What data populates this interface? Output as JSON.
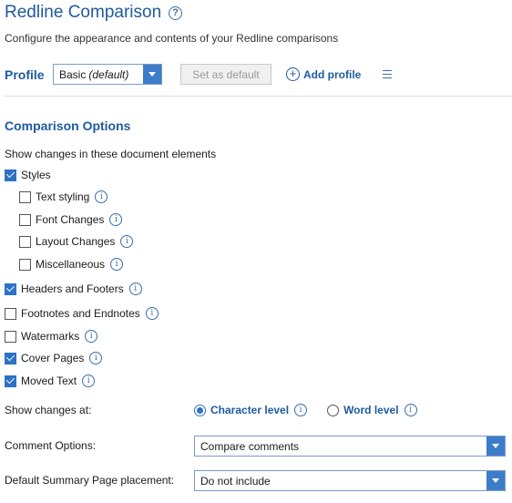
{
  "header": {
    "title": "Redline Comparison",
    "help_icon": "question-circle-icon",
    "subtitle": "Configure the appearance and contents of your Redline comparisons"
  },
  "profile": {
    "label": "Profile",
    "selected_name": "Basic",
    "selected_suffix": "(default)",
    "set_default_label": "Set as default",
    "set_default_enabled": false,
    "add_profile_label": "Add profile",
    "add_icon": "plus-circle-icon",
    "menu_icon": "hamburger-menu-icon"
  },
  "comparison": {
    "section_title": "Comparison Options",
    "elements_label": "Show changes in these document elements",
    "elements": [
      {
        "label": "Styles",
        "checked": true,
        "info": false
      },
      {
        "label": "Text styling",
        "checked": false,
        "info": true
      },
      {
        "label": "Font Changes",
        "checked": false,
        "info": true
      },
      {
        "label": "Layout Changes",
        "checked": false,
        "info": true
      },
      {
        "label": "Miscellaneous",
        "checked": false,
        "info": true
      },
      {
        "label": "Headers and Footers",
        "checked": true,
        "info": true
      },
      {
        "label": "Footnotes and Endnotes",
        "checked": false,
        "info": true
      },
      {
        "label": "Watermarks",
        "checked": false,
        "info": true
      },
      {
        "label": "Cover Pages",
        "checked": true,
        "info": true
      },
      {
        "label": "Moved Text",
        "checked": true,
        "info": true
      }
    ],
    "changes_at_label": "Show changes at:",
    "level_options": [
      {
        "label": "Character level",
        "selected": true
      },
      {
        "label": "Word level",
        "selected": false
      }
    ],
    "comment_options_label": "Comment Options:",
    "comment_options_value": "Compare comments",
    "summary_label": "Default Summary Page placement:",
    "summary_value": "Do not include"
  },
  "colors": {
    "accent": "#1e5a9e",
    "check_fill": "#2d72c4",
    "dropdown_button": "#3d7cc9"
  }
}
